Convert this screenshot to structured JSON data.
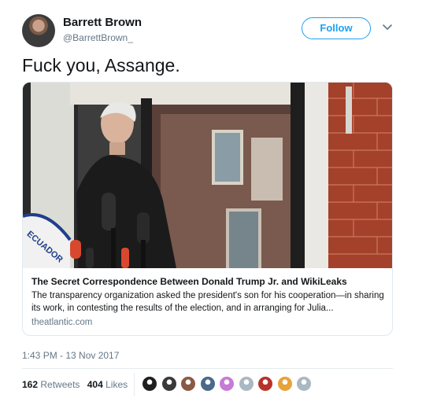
{
  "author": {
    "display_name": "Barrett Brown",
    "handle": "@BarrettBrown_"
  },
  "follow_label": "Follow",
  "tweet_text": "Fuck you, Assange.",
  "card": {
    "image_icon": "photo-of-man-at-window-with-microphones",
    "sign_text": "ECUADOR",
    "title": "The Secret Correspondence Between Donald Trump Jr. and WikiLeaks",
    "description": "The transparency organization asked the president's son for his cooperation—in sharing its work, in contesting the results of the election, and in arranging for Julia...",
    "domain": "theatlantic.com"
  },
  "timestamp": "1:43 PM - 13 Nov 2017",
  "stats": {
    "retweets_count": "162",
    "retweets_label": "Retweets",
    "likes_count": "404",
    "likes_label": "Likes"
  },
  "liker_avatars": [
    {
      "icon": "avatar-1",
      "color": "#1f1f1f"
    },
    {
      "icon": "avatar-2",
      "color": "#3a3a3a"
    },
    {
      "icon": "avatar-3",
      "color": "#8a5a44"
    },
    {
      "icon": "avatar-4",
      "color": "#4a6a8a"
    },
    {
      "icon": "avatar-5",
      "color": "#c77ad6"
    },
    {
      "icon": "avatar-6",
      "color": "#aab8c2"
    },
    {
      "icon": "avatar-7",
      "color": "#b8322a"
    },
    {
      "icon": "avatar-8",
      "color": "#e8a23a"
    },
    {
      "icon": "avatar-9",
      "color": "#aab8c2"
    }
  ],
  "colors": {
    "accent": "#1da1f2",
    "text": "#14171a",
    "secondary": "#657786",
    "border": "#e1e8ed"
  }
}
